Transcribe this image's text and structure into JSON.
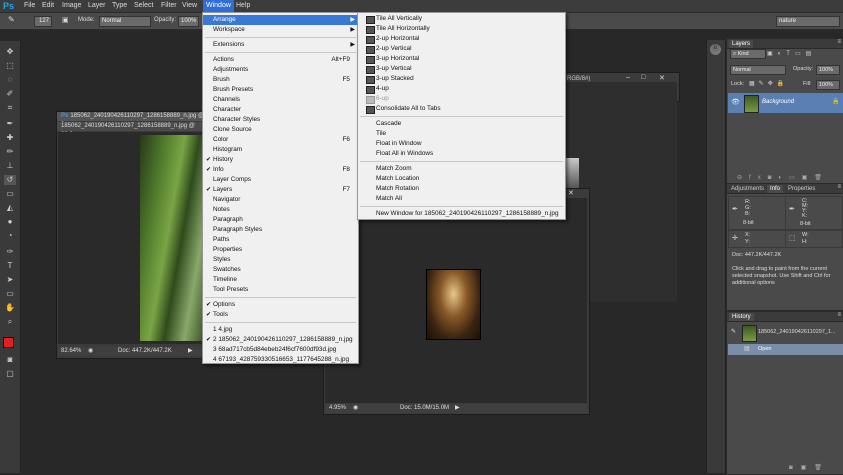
{
  "app": {
    "logo": "Ps"
  },
  "menubar": {
    "items": [
      "File",
      "Edit",
      "Image",
      "Layer",
      "Type",
      "Select",
      "Filter",
      "View",
      "Window",
      "Help"
    ],
    "active": "Window"
  },
  "options": {
    "brush_size": "127",
    "mode_label": "Mode:",
    "mode_value": "Normal",
    "opacity_label": "Opacity:",
    "opacity_value": "100%",
    "workspace": "nature"
  },
  "window_menu": {
    "items": [
      {
        "label": "Arrange",
        "shortcut": "",
        "check": false,
        "submenu": true,
        "highlight": true
      },
      {
        "label": "Workspace",
        "shortcut": "",
        "check": false,
        "submenu": true
      },
      {
        "sep": true
      },
      {
        "label": "Extensions",
        "shortcut": "",
        "check": false,
        "submenu": true
      },
      {
        "sep": true
      },
      {
        "label": "Actions",
        "shortcut": "Alt+F9",
        "check": false
      },
      {
        "label": "Adjustments",
        "shortcut": "",
        "check": false
      },
      {
        "label": "Brush",
        "shortcut": "F5",
        "check": false
      },
      {
        "label": "Brush Presets",
        "shortcut": "",
        "check": false
      },
      {
        "label": "Channels",
        "shortcut": "",
        "check": false
      },
      {
        "label": "Character",
        "shortcut": "",
        "check": false
      },
      {
        "label": "Character Styles",
        "shortcut": "",
        "check": false
      },
      {
        "label": "Clone Source",
        "shortcut": "",
        "check": false
      },
      {
        "label": "Color",
        "shortcut": "F6",
        "check": false
      },
      {
        "label": "Histogram",
        "shortcut": "",
        "check": false
      },
      {
        "label": "History",
        "shortcut": "",
        "check": true
      },
      {
        "label": "Info",
        "shortcut": "F8",
        "check": true
      },
      {
        "label": "Layer Comps",
        "shortcut": "",
        "check": false
      },
      {
        "label": "Layers",
        "shortcut": "F7",
        "check": true
      },
      {
        "label": "Navigator",
        "shortcut": "",
        "check": false
      },
      {
        "label": "Notes",
        "shortcut": "",
        "check": false
      },
      {
        "label": "Paragraph",
        "shortcut": "",
        "check": false
      },
      {
        "label": "Paragraph Styles",
        "shortcut": "",
        "check": false
      },
      {
        "label": "Paths",
        "shortcut": "",
        "check": false
      },
      {
        "label": "Properties",
        "shortcut": "",
        "check": false
      },
      {
        "label": "Styles",
        "shortcut": "",
        "check": false
      },
      {
        "label": "Swatches",
        "shortcut": "",
        "check": false
      },
      {
        "label": "Timeline",
        "shortcut": "",
        "check": false
      },
      {
        "label": "Tool Presets",
        "shortcut": "",
        "check": false
      },
      {
        "sep": true
      },
      {
        "label": "Options",
        "shortcut": "",
        "check": true
      },
      {
        "label": "Tools",
        "shortcut": "",
        "check": true
      },
      {
        "sep": true
      },
      {
        "label": "1 4.jpg",
        "shortcut": "",
        "check": false
      },
      {
        "label": "2 185062_240190426110297_1286158889_n.jpg",
        "shortcut": "",
        "check": true
      },
      {
        "label": "3 68ad717cb5d84ebeb24f6cf7600df93d.jpg",
        "shortcut": "",
        "check": false
      },
      {
        "label": "4 67193_428759330516653_1177645288_n.jpg",
        "shortcut": "",
        "check": false
      }
    ]
  },
  "arrange_menu": {
    "items": [
      {
        "label": "Tile All Vertically",
        "icon": true
      },
      {
        "label": "Tile All Horizontally",
        "icon": true
      },
      {
        "label": "2-up Horizontal",
        "icon": true
      },
      {
        "label": "2-up Vertical",
        "icon": true
      },
      {
        "label": "3-up Horizontal",
        "icon": true
      },
      {
        "label": "3-up Vertical",
        "icon": true
      },
      {
        "label": "3-up Stacked",
        "icon": true
      },
      {
        "label": "4-up",
        "icon": true
      },
      {
        "label": "6-up",
        "icon": true,
        "disabled": true
      },
      {
        "label": "Consolidate All to Tabs",
        "icon": true
      },
      {
        "sep": true
      },
      {
        "label": "Cascade"
      },
      {
        "label": "Tile"
      },
      {
        "label": "Float in Window"
      },
      {
        "label": "Float All in Windows"
      },
      {
        "sep": true
      },
      {
        "label": "Match Zoom"
      },
      {
        "label": "Match Location"
      },
      {
        "label": "Match Rotation"
      },
      {
        "label": "Match All"
      },
      {
        "sep": true
      },
      {
        "label": "New Window for 185062_240190426110297_1286158889_n.jpg"
      }
    ]
  },
  "doc1": {
    "title1": "185062_240190426110297_1286158889_n.jpg @ 8",
    "title2": "185062_240190426110297_1286158889_n.jpg @ 82.6",
    "zoom": "82.64%",
    "docsize": "Doc: 447.2K/447.2K"
  },
  "doc2": {
    "title_fragment": "RGB/8#)",
    "zoom": "4.95%",
    "docsize": "Doc: 15.0M/15.0M"
  },
  "layers_panel": {
    "tab": "Layers",
    "kind": "Kind",
    "blend": "Normal",
    "opacity_label": "Opacity:",
    "opacity_value": "100%",
    "lock_label": "Lock:",
    "fill_label": "Fill:",
    "fill_value": "100%",
    "layer_name": "Background"
  },
  "info_panel": {
    "tabs": [
      "Adjustments",
      "Info",
      "Properties"
    ],
    "rgb": [
      "R:",
      "G:",
      "B:"
    ],
    "bit1": "8-bit",
    "cmyk": [
      "C:",
      "M:",
      "Y:",
      "K:"
    ],
    "bit2": "8-bit",
    "xy": [
      "X:",
      "Y:"
    ],
    "wh": [
      "W:",
      "H:"
    ],
    "doc": "Doc: 447.2K/447.2K",
    "hint": "Click and drag to paint from the current selected snapshot.  Use Shift and Ctrl for additional options"
  },
  "history_panel": {
    "tab": "History",
    "snapshot": "185062_240190426110297_1...",
    "step": "Open"
  }
}
